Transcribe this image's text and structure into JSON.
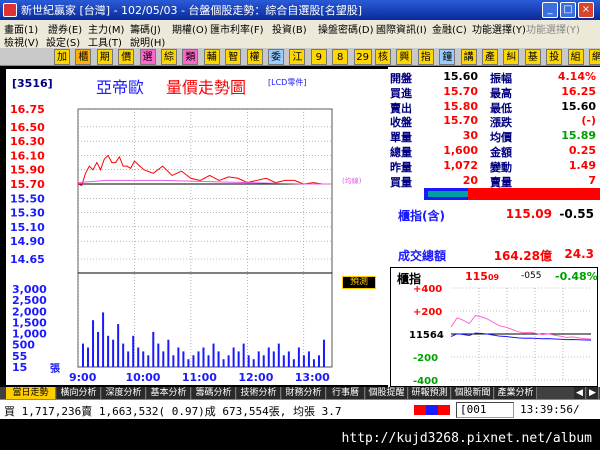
{
  "window": {
    "title": "新世紀贏家 [台灣] - 102/05/03 - 台盤個股走勢：綜合自選股[名望股]"
  },
  "menu": {
    "row1": [
      "畫面(1)",
      "證券(E)",
      "主力(M)",
      "籌碼(J)",
      "期權(O)",
      "匯市利率(F)",
      "投資(B)",
      "操盤密碼(D)",
      "國際資訊(I)",
      "金融(C)",
      "功能選擇(Y)",
      "功能選擇(Y)"
    ],
    "row2": [
      "檢視(V)",
      "設定(S)",
      "工具(T)",
      "說明(H)"
    ]
  },
  "toolbar": {
    "buttons": [
      "加",
      "櫃",
      "期",
      "價",
      "選",
      "綜",
      "類",
      "輔",
      "智",
      "權",
      "委",
      "江",
      "9",
      "8",
      "29",
      "核",
      "興",
      "指",
      "鐘",
      "講",
      "產",
      "糾",
      "基",
      "投",
      "組",
      "網"
    ]
  },
  "chart": {
    "stock_code": "[3516]",
    "stock_name": "亞帝歐",
    "chart_title": "量價走勢圖",
    "chart_tag": "[LCD零件]",
    "avg_label": "(均線)",
    "predict_label": "預測",
    "unit_label": "張"
  },
  "quote": {
    "rows": [
      {
        "l1": "開盤",
        "v1": "15.60",
        "c1": "#000000",
        "l2": "振幅",
        "v2": "4.14%",
        "c2": "#ff0000"
      },
      {
        "l1": "買進",
        "v1": "15.70",
        "c1": "#ff0000",
        "l2": "最高",
        "v2": "16.25",
        "c2": "#ff0000"
      },
      {
        "l1": "賣出",
        "v1": "15.80",
        "c1": "#ff0000",
        "l2": "最低",
        "v2": "15.60",
        "c2": "#000000"
      },
      {
        "l1": "收盤",
        "v1": "15.70",
        "c1": "#ff0000",
        "l2": "漲跌",
        "v2": "(-)",
        "c2": "#ff0000"
      },
      {
        "l1": "單量",
        "v1": "30",
        "c1": "#ff0000",
        "l2": "均價",
        "v2": "15.89",
        "c2": "#00a000"
      },
      {
        "l1": "總量",
        "v1": "1,600",
        "c1": "#ff0000",
        "l2": "金額",
        "v2": "0.25",
        "c2": "#ff0000"
      },
      {
        "l1": "昨量",
        "v1": "1,072",
        "c1": "#ff0000",
        "l2": "變動",
        "v2": "1.49",
        "c2": "#ff0000"
      },
      {
        "l1": "買量",
        "v1": "20",
        "c1": "#ff0000",
        "l2": "賣量",
        "v2": "7",
        "c2": "#ff0000"
      }
    ],
    "index_label": "櫃指(含)",
    "index_value": "115.09",
    "index_change": "-0.55",
    "turnover_label": "成交總額",
    "turnover_value": "164.28億",
    "turnover_right": "24.3"
  },
  "otc": {
    "label": "櫃指",
    "value": "115",
    "value_sub": "09",
    "change": "-055",
    "change_pct": "-0.48%",
    "y_labels": [
      "+400",
      "+200",
      "11564",
      "-200",
      "-400"
    ]
  },
  "tabs": [
    "當日走勢",
    "橫向分析",
    "深度分析",
    "基本分析",
    "籌碼分析",
    "技術分析",
    "財務分析",
    "行事曆",
    "個股提醒",
    "研報預測",
    "個股新聞",
    "產業分析"
  ],
  "status": {
    "text": "買 1,717,236賣 1,663,532( 0.97)成 673,554張, 均張 3.7",
    "code_box": "[001",
    "time": "13:39:56/"
  },
  "watermark": {
    "text": "http://kujd3268.pixnet.net/album"
  },
  "chart_data": [
    {
      "type": "line",
      "y_ticks": [
        "16.75",
        "16.50",
        "16.30",
        "16.10",
        "15.90",
        "15.70",
        "15.50",
        "15.30",
        "15.10",
        "14.90",
        "14.65"
      ],
      "ylim": [
        14.65,
        16.75
      ],
      "x_ticks": [
        "9:00",
        "10:00",
        "11:00",
        "12:00",
        "13:00"
      ],
      "x_minutes_range": [
        0,
        270
      ],
      "series": [
        {
          "color": "#ff0000",
          "minutes": [
            0,
            4,
            8,
            12,
            16,
            20,
            24,
            28,
            32,
            36,
            40,
            44,
            48,
            52,
            56,
            60,
            70,
            80,
            90,
            100,
            110,
            120,
            130,
            140,
            150,
            160,
            170,
            180,
            190,
            200,
            210,
            220,
            230,
            240,
            250,
            260,
            270
          ],
          "values": [
            15.7,
            15.68,
            15.85,
            15.95,
            15.9,
            16.0,
            15.9,
            16.05,
            16.1,
            16.0,
            16.0,
            16.08,
            15.95,
            15.95,
            15.92,
            16.02,
            15.9,
            15.85,
            15.95,
            15.82,
            15.88,
            15.78,
            15.75,
            15.82,
            15.75,
            15.8,
            15.78,
            15.72,
            15.75,
            15.78,
            15.72,
            15.75,
            15.75,
            15.7,
            15.72,
            15.7,
            15.7
          ]
        },
        {
          "color": "#e060e0",
          "minutes": [
            0,
            30,
            60,
            90,
            120,
            150,
            180,
            210,
            240,
            270
          ],
          "values": [
            15.72,
            15.75,
            15.75,
            15.75,
            15.74,
            15.73,
            15.72,
            15.71,
            15.7,
            15.7
          ]
        }
      ]
    },
    {
      "type": "bar",
      "y_ticks": [
        "3,000",
        "2,500",
        "2,000",
        "1,500",
        "1,000",
        "500",
        "55",
        "15"
      ],
      "volume_bars": [
        30,
        25,
        60,
        45,
        70,
        40,
        35,
        55,
        30,
        20,
        40,
        25,
        20,
        15,
        45,
        30,
        20,
        35,
        15,
        25,
        20,
        10,
        15,
        20,
        25,
        15,
        30,
        20,
        10,
        15,
        25,
        20,
        30,
        15,
        10,
        20,
        15,
        25,
        20,
        30,
        15,
        20,
        10,
        25,
        15,
        20,
        10,
        15,
        35
      ]
    },
    {
      "type": "line",
      "name": "otc-mini",
      "ylim": [
        -400,
        400
      ],
      "values": [
        60,
        140,
        120,
        90,
        160,
        150,
        130,
        100,
        70,
        60,
        40,
        20,
        10,
        15,
        5,
        -5,
        0,
        -10,
        -20,
        -30,
        -25,
        -35,
        -40,
        -45
      ]
    }
  ],
  "colors": {
    "up": "#ff0000",
    "down": "#00a000",
    "avg_line": "#e060e0",
    "chart_bg": "#ffffff",
    "title_bar": "#0a2a9a",
    "accent_blue": "#1a1aff"
  }
}
